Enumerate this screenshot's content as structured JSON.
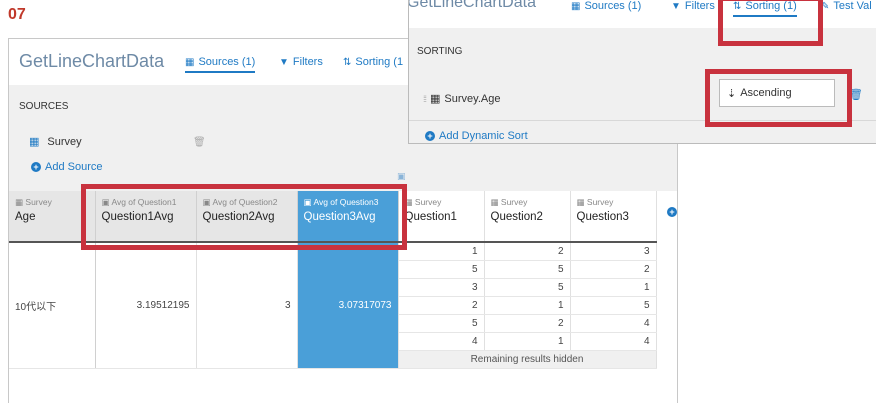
{
  "step_number": "07",
  "main": {
    "title": "GetLineChartData",
    "tabs": [
      {
        "label": "Sources (1)",
        "icon": "grid-icon",
        "active": true
      },
      {
        "label": "Filters",
        "icon": "funnel-icon"
      },
      {
        "label": "Sorting (1",
        "icon": "sort-icon"
      }
    ],
    "sources_label": "SOURCES",
    "source_item": "Survey",
    "add_source": "Add Source"
  },
  "table": {
    "columns": [
      {
        "source": "Survey",
        "name": "Age"
      },
      {
        "source": "Avg of Question1",
        "name": "Question1Avg"
      },
      {
        "source": "Avg of Question2",
        "name": "Question2Avg"
      },
      {
        "source": "Avg of Question3",
        "name": "Question3Avg"
      },
      {
        "source": "Survey",
        "name": "Question1"
      },
      {
        "source": "Survey",
        "name": "Question2"
      },
      {
        "source": "Survey",
        "name": "Question3"
      }
    ],
    "age_value": "10代以下",
    "avg_values": [
      "3.19512195",
      "3",
      "3.07317073"
    ],
    "rows": [
      [
        "1",
        "2",
        "3"
      ],
      [
        "5",
        "5",
        "2"
      ],
      [
        "3",
        "5",
        "1"
      ],
      [
        "2",
        "1",
        "5"
      ],
      [
        "5",
        "2",
        "4"
      ],
      [
        "4",
        "1",
        "4"
      ]
    ],
    "remaining": "Remaining results hidden"
  },
  "popup": {
    "title": "GetLineChartData",
    "tabs": [
      {
        "label": "Sources (1)",
        "icon": "grid-icon"
      },
      {
        "label": "Filters",
        "icon": "funnel-icon"
      },
      {
        "label": "Sorting (1)",
        "icon": "sort-icon",
        "active": true
      },
      {
        "label": "Test Val",
        "icon": "edit-icon"
      }
    ],
    "sorting_label": "SORTING",
    "sort_field": "Survey.Age",
    "sort_order": "Ascending",
    "add_dynamic_sort": "Add Dynamic Sort"
  },
  "colors": {
    "accent": "#1f7ac4",
    "highlight": "#c8323e",
    "selected_column": "#4a9fd8",
    "step": "#c0392b"
  }
}
